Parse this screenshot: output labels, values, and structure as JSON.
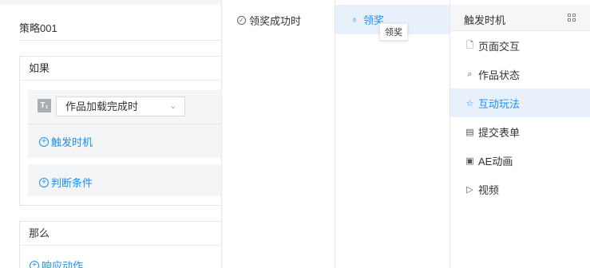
{
  "strategy": {
    "name": "策略001"
  },
  "if_card": {
    "title": "如果",
    "trigger_type_icon": "T₁",
    "trigger_select_value": "作品加载完成时",
    "add_trigger_label": "触发时机",
    "add_condition_label": "判断条件"
  },
  "then_card": {
    "title": "那么",
    "add_action_label": "响应动作"
  },
  "col2": {
    "item_label": "领奖成功时",
    "icon": "check-circle-icon"
  },
  "col3": {
    "item_label": "领奖",
    "tooltip": "领奖",
    "icon": "bulb-icon"
  },
  "col4": {
    "title": "触发时机",
    "categories": [
      {
        "label": "页面交互",
        "icon": "file-icon"
      },
      {
        "label": "作品状态",
        "icon": "tag-icon"
      },
      {
        "label": "互动玩法",
        "icon": "star-icon"
      },
      {
        "label": "提交表单",
        "icon": "form-icon"
      },
      {
        "label": "AE动画",
        "icon": "image-icon"
      },
      {
        "label": "视频",
        "icon": "play-icon"
      }
    ]
  },
  "colors": {
    "accent": "#1890ff",
    "active_bg": "#e8f1fb"
  }
}
